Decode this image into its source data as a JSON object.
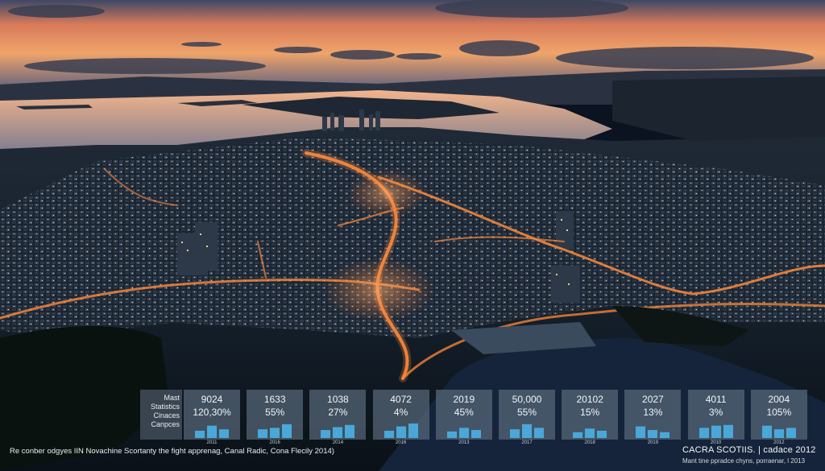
{
  "stats": {
    "row_labels": [
      "Mast",
      "Statistics",
      "Cinaces",
      "Canpces"
    ],
    "cards": [
      {
        "value": "9024",
        "change": "120,30%",
        "year": "2011",
        "bars": [
          0.5,
          0.85,
          0.6
        ]
      },
      {
        "value": "1633",
        "change": "55%",
        "year": "2016",
        "bars": [
          0.6,
          0.7,
          0.95
        ]
      },
      {
        "value": "1038",
        "change": "27%",
        "year": "2014",
        "bars": [
          0.55,
          0.75,
          0.9
        ]
      },
      {
        "value": "4072",
        "change": "4%",
        "year": "2016",
        "bars": [
          0.5,
          0.8,
          1.0
        ]
      },
      {
        "value": "2019",
        "change": "45%",
        "year": "2013",
        "bars": [
          0.45,
          0.7,
          0.55
        ]
      },
      {
        "value": "50,000",
        "change": "55%",
        "year": "2017",
        "bars": [
          0.6,
          0.95,
          0.7
        ]
      },
      {
        "value": "20102",
        "change": "15%",
        "year": "2018",
        "bars": [
          0.4,
          0.65,
          0.5
        ]
      },
      {
        "value": "2027",
        "change": "13%",
        "year": "2019",
        "bars": [
          0.8,
          0.55,
          0.4
        ]
      },
      {
        "value": "4011",
        "change": "3%",
        "year": "2010",
        "bars": [
          0.7,
          0.85,
          0.9
        ]
      },
      {
        "value": "2004",
        "change": "105%",
        "year": "2012",
        "bars": [
          0.85,
          0.6,
          0.7
        ]
      }
    ]
  },
  "caption": "Re conber odgyes IIN Novachine Scortanty the fight apprenag, Canal Radic, Cona Flecily 2014)",
  "brand": {
    "title": "CACRA SCOTIIS. | cadace 2012",
    "subtitle": "Mant tine ppradce chyns, porraenar, l 2013"
  },
  "colors": {
    "bar": "#4aa8d8",
    "card": "#586878",
    "road_glow": "#ff8a3a"
  }
}
